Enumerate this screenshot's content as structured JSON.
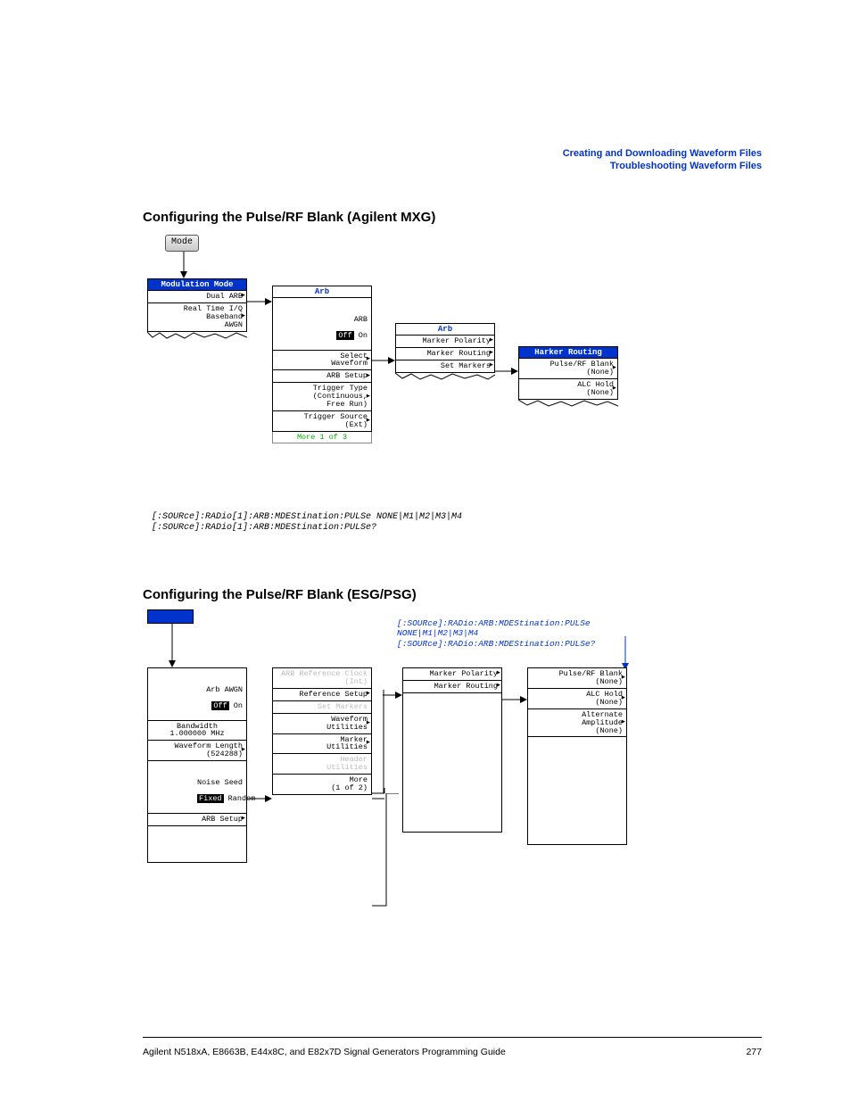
{
  "header": {
    "line1": "Creating and Downloading Waveform Files",
    "line2": "Troubleshooting Waveform Files"
  },
  "section1": {
    "title": "Configuring the Pulse/RF Blank (Agilent MXG)",
    "mode": "Mode",
    "col1": {
      "hdr": "Modulation Mode",
      "i1": "Dual ARB",
      "i2": "Real Time I/Q\n    Baseband\n        AWGN"
    },
    "col2": {
      "hdr": "Arb",
      "i1_label": "ARB",
      "i1_off": "Off",
      "i1_on": "On",
      "i2": "Select\nWaveform",
      "i3": "ARB Setup",
      "i4": "Trigger Type\n(Continuous,\n   Free Run)",
      "i5": "Trigger Source\n(Ext)",
      "ftr": "More 1 of 3"
    },
    "col3": {
      "hdr": "Arb",
      "i1": "Marker Polarity",
      "i2": "Marker Routing",
      "i3": "Set Markers"
    },
    "col4": {
      "hdr": "Harker Routing",
      "i1": "Pulse/RF Blank\n(None)",
      "i2": "ALC Hold\n(None)"
    },
    "scpi1": "[:SOURce]:RADio[1]:ARB:MDEStination:PULSe NONE|M1|M2|M3|M4",
    "scpi2": "[:SOURce]:RADio[1]:ARB:MDEStination:PULSe?"
  },
  "section2": {
    "title": "Configuring the Pulse/RF Blank (ESG/PSG)",
    "scpi1": "[:SOURce]:RADio:ARB:MDEStination:PULSe NONE|M1|M2|M3|M4",
    "scpi2": "[:SOURce]:RADio:ARB:MDEStination:PULSe?",
    "col1": {
      "i1_label": "Arb AWGN",
      "i1_off": "Off",
      "i1_on": "On",
      "i2": "Bandwidth\n1.000000 MHz",
      "i3": "Waveform Length\n(524288)",
      "i4": "Noise Seed",
      "i4_fixed": "Fixed",
      "i4_random": "Random",
      "i5": "ARB Setup"
    },
    "col2": {
      "i1": "ARB Reference Clock\n(Int)",
      "i2": "Reference Setup",
      "i3": "Set Markers",
      "i4": "Waveform\nUtilities",
      "i5": "Marker\nUtilities",
      "i6": "Header\nUtilities",
      "ftr": "More\n(1 of 2)"
    },
    "col3": {
      "i1": "Marker Polarity",
      "i2": "Marker Routing"
    },
    "col4": {
      "i1": "Pulse/RF Blank\n(None)",
      "i2": "ALC Hold\n(None)",
      "i3": "Alternate\nAmplitude\n(None)"
    }
  },
  "footer": {
    "left": "Agilent N518xA, E8663B, E44x8C, and E82x7D Signal Generators Programming Guide",
    "right": "277"
  }
}
